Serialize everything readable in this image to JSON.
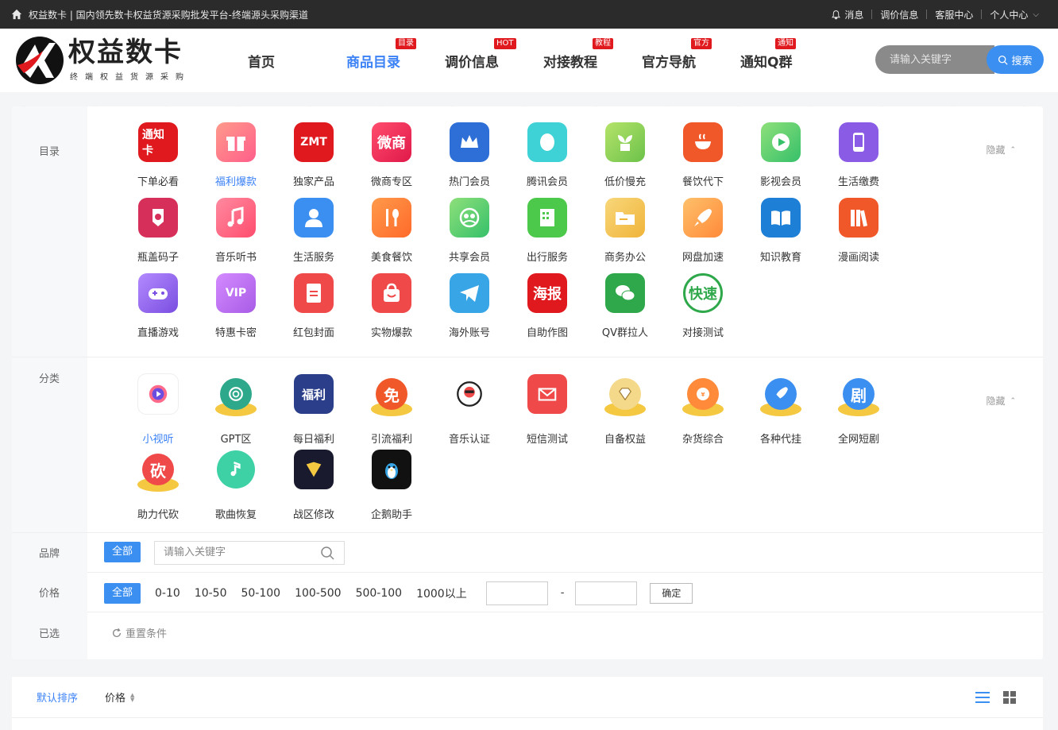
{
  "topbar": {
    "title": "权益数卡 | 国内领先数卡权益货源采购批发平台-终端源头采购渠道",
    "links": [
      "消息",
      "调价信息",
      "客服中心",
      "个人中心"
    ]
  },
  "header": {
    "logo_title": "权益数卡",
    "logo_sub": "终端权益货源采购",
    "nav": [
      {
        "label": "首页",
        "badge": ""
      },
      {
        "label": "商品目录",
        "badge": "目录"
      },
      {
        "label": "调价信息",
        "badge": "HOT"
      },
      {
        "label": "对接教程",
        "badge": "教程"
      },
      {
        "label": "官方导航",
        "badge": "官方"
      },
      {
        "label": "通知Q群",
        "badge": "通知"
      }
    ],
    "search_placeholder": "请输入关键字",
    "search_button": "搜索"
  },
  "filters": {
    "catalog_label": "目录",
    "category_label": "分类",
    "brand_label": "品牌",
    "price_label": "价格",
    "selected_label": "已选",
    "hide_label": "隐藏",
    "catalog": [
      {
        "label": "下单必看",
        "icon": "tongzhi-icon",
        "text": "通知卡"
      },
      {
        "label": "福利爆款",
        "icon": "gift-icon",
        "text": ""
      },
      {
        "label": "独家产品",
        "icon": "zmt-icon",
        "text": "ZMT"
      },
      {
        "label": "微商专区",
        "icon": "weishang-icon",
        "text": "微商"
      },
      {
        "label": "热门会员",
        "icon": "crown-icon",
        "text": ""
      },
      {
        "label": "腾讯会员",
        "icon": "qq-penguin-icon",
        "text": ""
      },
      {
        "label": "低价慢充",
        "icon": "plant-icon",
        "text": ""
      },
      {
        "label": "餐饮代下",
        "icon": "coffee-cup-icon",
        "text": ""
      },
      {
        "label": "影视会员",
        "icon": "play-icon",
        "text": ""
      },
      {
        "label": "生活缴费",
        "icon": "phone-icon",
        "text": ""
      },
      {
        "label": "瓶盖码子",
        "icon": "medal-icon",
        "text": ""
      },
      {
        "label": "音乐听书",
        "icon": "music-note-icon",
        "text": ""
      },
      {
        "label": "生活服务",
        "icon": "person-icon",
        "text": ""
      },
      {
        "label": "美食餐饮",
        "icon": "fork-spoon-icon",
        "text": ""
      },
      {
        "label": "共享会员",
        "icon": "group-icon",
        "text": ""
      },
      {
        "label": "出行服务",
        "icon": "building-icon",
        "text": ""
      },
      {
        "label": "商务办公",
        "icon": "folder-icon",
        "text": ""
      },
      {
        "label": "网盘加速",
        "icon": "rocket-icon",
        "text": ""
      },
      {
        "label": "知识教育",
        "icon": "book-icon",
        "text": ""
      },
      {
        "label": "漫画阅读",
        "icon": "books-icon",
        "text": ""
      },
      {
        "label": "直播游戏",
        "icon": "gamepad-icon",
        "text": ""
      },
      {
        "label": "特惠卡密",
        "icon": "vip-icon",
        "text": "VIP"
      },
      {
        "label": "红包封面",
        "icon": "red-packet-icon",
        "text": ""
      },
      {
        "label": "实物爆款",
        "icon": "shopping-bag-icon",
        "text": ""
      },
      {
        "label": "海外账号",
        "icon": "telegram-icon",
        "text": ""
      },
      {
        "label": "自助作图",
        "icon": "poster-icon",
        "text": "海报"
      },
      {
        "label": "QV群拉人",
        "icon": "wechat-icon",
        "text": ""
      },
      {
        "label": "对接测试",
        "icon": "test-icon",
        "text": "快速"
      }
    ],
    "categories": [
      {
        "label": "小视听",
        "icon": "video-player-icon",
        "text": ""
      },
      {
        "label": "GPT区",
        "icon": "openai-icon",
        "text": ""
      },
      {
        "label": "每日福利",
        "icon": "fuli-icon",
        "text": "福利"
      },
      {
        "label": "引流福利",
        "icon": "mian-icon",
        "text": "免"
      },
      {
        "label": "音乐认证",
        "icon": "dj-avatar-icon",
        "text": ""
      },
      {
        "label": "短信测试",
        "icon": "envelope-icon",
        "text": ""
      },
      {
        "label": "自备权益",
        "icon": "diamond-icon",
        "text": ""
      },
      {
        "label": "杂货综合",
        "icon": "coin-icon",
        "text": ""
      },
      {
        "label": "各种代挂",
        "icon": "rocket-icon",
        "text": ""
      },
      {
        "label": "全网短剧",
        "icon": "ju-icon",
        "text": "剧"
      },
      {
        "label": "助力代砍",
        "icon": "kan-icon",
        "text": "砍"
      },
      {
        "label": "歌曲恢复",
        "icon": "music-circle-icon",
        "text": ""
      },
      {
        "label": "战区修改",
        "icon": "shield-v-icon",
        "text": ""
      },
      {
        "label": "企鹅助手",
        "icon": "penguin-icon",
        "text": ""
      }
    ],
    "brand_all": "全部",
    "brand_placeholder": "请输入关键字",
    "price_all": "全部",
    "price_ranges": [
      "0-10",
      "10-50",
      "50-100",
      "100-500",
      "500-100",
      "1000以上"
    ],
    "price_confirm": "确定",
    "reset_label": "重置条件"
  },
  "sortbar": {
    "default_sort": "默认排序",
    "price_sort": "价格"
  },
  "colors": {
    "accent": "#3b8ff0",
    "badge": "#e0191e",
    "topbar": "#2b2b2b"
  }
}
